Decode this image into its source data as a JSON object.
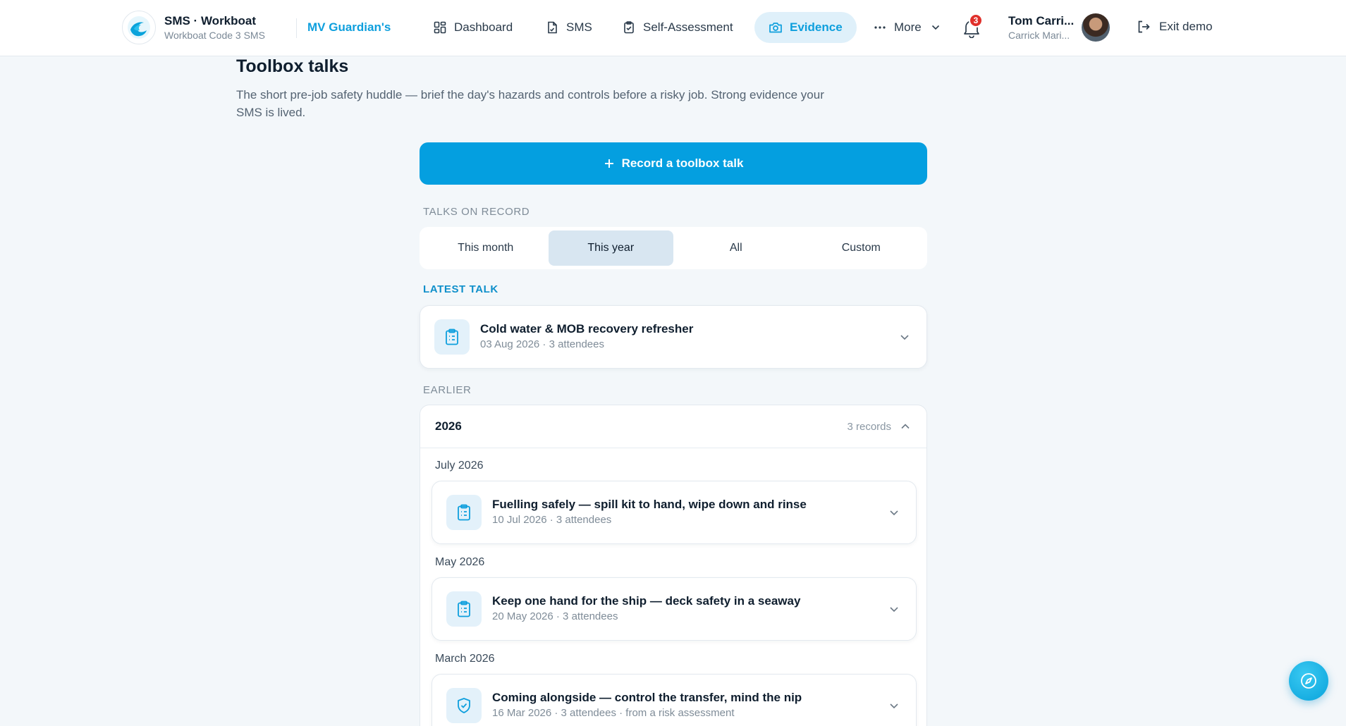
{
  "brand": {
    "title": "SMS · Workboat",
    "subtitle": "Workboat Code 3 SMS"
  },
  "vessel": "MV Guardian's",
  "nav": {
    "dashboard": "Dashboard",
    "sms": "SMS",
    "self_assessment": "Self-Assessment",
    "evidence": "Evidence",
    "more": "More"
  },
  "notifications": {
    "count": "3"
  },
  "user": {
    "name": "Tom Carri...",
    "org": "Carrick Mari..."
  },
  "exit_label": "Exit demo",
  "page": {
    "title": "Toolbox talks",
    "description": "The short pre-job safety huddle — brief the day's hazards and controls before a risky job. Strong evidence your SMS is lived."
  },
  "record_button": "Record a toolbox talk",
  "talks_on_record_label": "TALKS ON RECORD",
  "filters": [
    {
      "label": "This month",
      "active": false
    },
    {
      "label": "This year",
      "active": true
    },
    {
      "label": "All",
      "active": false
    },
    {
      "label": "Custom",
      "active": false
    }
  ],
  "latest": {
    "label": "LATEST TALK",
    "title": "Cold water & MOB recovery refresher",
    "meta": "03 Aug 2026 · 3 attendees",
    "icon": "clipboard-icon"
  },
  "earlier": {
    "label": "EARLIER",
    "year": "2026",
    "count": "3 records",
    "groups": [
      {
        "month": "July 2026",
        "talks": [
          {
            "title": "Fuelling safely — spill kit to hand, wipe down and rinse",
            "meta": "10 Jul 2026 · 3 attendees",
            "icon": "clipboard-icon"
          }
        ]
      },
      {
        "month": "May 2026",
        "talks": [
          {
            "title": "Keep one hand for the ship — deck safety in a seaway",
            "meta": "20 May 2026 · 3 attendees",
            "icon": "clipboard-icon"
          }
        ]
      },
      {
        "month": "March 2026",
        "talks": [
          {
            "title": "Coming alongside — control the transfer, mind the nip",
            "meta": "16 Mar 2026 · 3 attendees · from a risk assessment",
            "icon": "shield-check-icon"
          }
        ]
      }
    ]
  },
  "colors": {
    "accent": "#049fe0",
    "active_nav_bg": "#dff0fa",
    "badge": "#e0302b",
    "page_bg": "#f3f7fa"
  }
}
